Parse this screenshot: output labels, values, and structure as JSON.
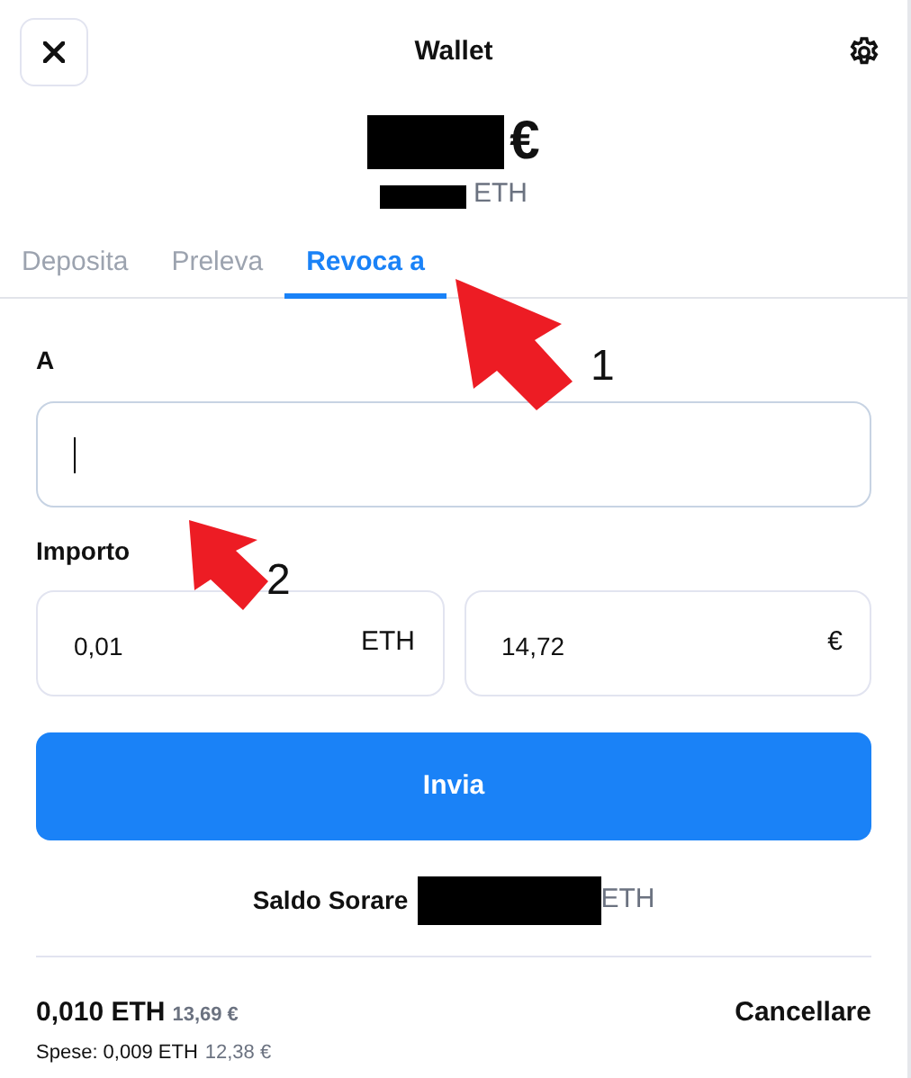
{
  "window": {
    "title": "Wallet"
  },
  "balance": {
    "currency": "€",
    "eth_unit": "ETH"
  },
  "tabs": [
    {
      "label": "Deposita",
      "selected": false
    },
    {
      "label": "Preleva",
      "selected": false
    },
    {
      "label": "Revoca a",
      "selected": true
    }
  ],
  "recipient": {
    "label": "A",
    "focused": true
  },
  "amount": {
    "label": "Importo",
    "eth_value": "0,01",
    "eth_unit": "ETH",
    "eur_value": "14,72",
    "eur_unit": "€"
  },
  "send_button": "Invia",
  "sorare_balance": {
    "label": "Saldo Sorare",
    "unit": "ETH"
  },
  "summary": {
    "total_eth": "0,010 ETH",
    "total_eur": "13,69 €",
    "fees_label": "Spese: 0,009 ETH",
    "fees_eur": "12,38 €",
    "cancel": "Cancellare"
  },
  "annotations": [
    {
      "label": "1"
    },
    {
      "label": "2"
    }
  ]
}
